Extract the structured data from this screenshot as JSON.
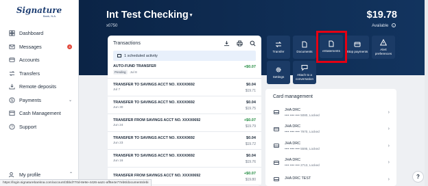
{
  "logo": {
    "main": "Signature",
    "sub": "Bank, N.A."
  },
  "sidebar": {
    "items": [
      {
        "label": "Dashboard",
        "icon": "dashboard-icon"
      },
      {
        "label": "Messages",
        "icon": "mail-icon",
        "badge": "4"
      },
      {
        "label": "Accounts",
        "icon": "accounts-icon"
      },
      {
        "label": "Transfers",
        "icon": "transfer-icon"
      },
      {
        "label": "Remote deposits",
        "icon": "deposit-icon"
      },
      {
        "label": "Payments",
        "icon": "payments-icon",
        "has_chevron": true
      },
      {
        "label": "Cash Management",
        "icon": "cash-icon"
      },
      {
        "label": "Support",
        "icon": "support-icon"
      }
    ],
    "profile": "My profile"
  },
  "header": {
    "account_name": "Int Test Checking",
    "account_number": "x0750",
    "balance": "$19.78",
    "available_label": "Available"
  },
  "transactions": {
    "title": "Transactions",
    "scheduled": "1 scheduled activity",
    "rows": [
      {
        "desc": "AUTO-FUND TRANSFER",
        "date": "Jul 8",
        "pending": "Pending",
        "amount": "+$0.07",
        "positive": true,
        "balance": ""
      },
      {
        "desc": "TRANSFER TO SAVINGS ACCT NO. XXXX0692",
        "date": "Jul 7",
        "amount": "$0.04",
        "positive": false,
        "balance": "$19.71"
      },
      {
        "desc": "TRANSFER TO SAVINGS ACCT NO. XXXX0692",
        "date": "Jun 30",
        "amount": "$0.04",
        "positive": false,
        "balance": "$19.75"
      },
      {
        "desc": "TRANSFER FROM SAVINGS ACCT NO. XXXX0692",
        "date": "Jun 24",
        "amount": "+$0.07",
        "positive": true,
        "balance": "$19.79"
      },
      {
        "desc": "TRANSFER TO SAVINGS ACCT NO. XXXX0692",
        "date": "Jun 23",
        "amount": "$0.04",
        "positive": false,
        "balance": "$19.72"
      },
      {
        "desc": "TRANSFER TO SAVINGS ACCT NO. XXXX0692",
        "date": "Jun 16",
        "amount": "$0.04",
        "positive": false,
        "balance": "$19.76"
      },
      {
        "desc": "TRANSFER FROM SAVINGS ACCT NO. XXXX0692",
        "date": "",
        "amount": "+$0.07",
        "positive": true,
        "balance": "$19.80"
      }
    ]
  },
  "actions": [
    {
      "label": "Transfer",
      "icon": "transfer-icon"
    },
    {
      "label": "Documents",
      "icon": "document-icon"
    },
    {
      "label": "eStatements",
      "icon": "estatement-icon"
    },
    {
      "label": "Stop payments",
      "icon": "stop-payment-icon"
    },
    {
      "label": "Alert preferences",
      "icon": "alert-icon"
    },
    {
      "label": "Settings",
      "icon": "gear-icon"
    },
    {
      "label": "Attach to a conversation",
      "icon": "chat-icon"
    }
  ],
  "card_management": {
    "title": "Card management",
    "cards": [
      {
        "name": "JHA DRC",
        "detail": "•••• •••• •••• 5080, Locked"
      },
      {
        "name": "JHA DRC",
        "detail": "•••• •••• •••• 7970, Locked"
      },
      {
        "name": "JHA DRC",
        "detail": "•••• •••• •••• 5595, Locked"
      },
      {
        "name": "JHA DRC",
        "detail": "•••• •••• •••• 2713, Locked"
      },
      {
        "name": "JHA DRC TEST",
        "detail": ""
      }
    ]
  },
  "statusbar": "https://login.signaturebankna.com/account/3bbd770d-8e9e-4426-aa2c-aff6e4e77eb6/documents/ebi",
  "colors": {
    "header": "#0b2446",
    "tile": "#1b3b66",
    "highlight": "#e60012",
    "positive": "#1f8a3d",
    "badge": "#e2473a"
  }
}
